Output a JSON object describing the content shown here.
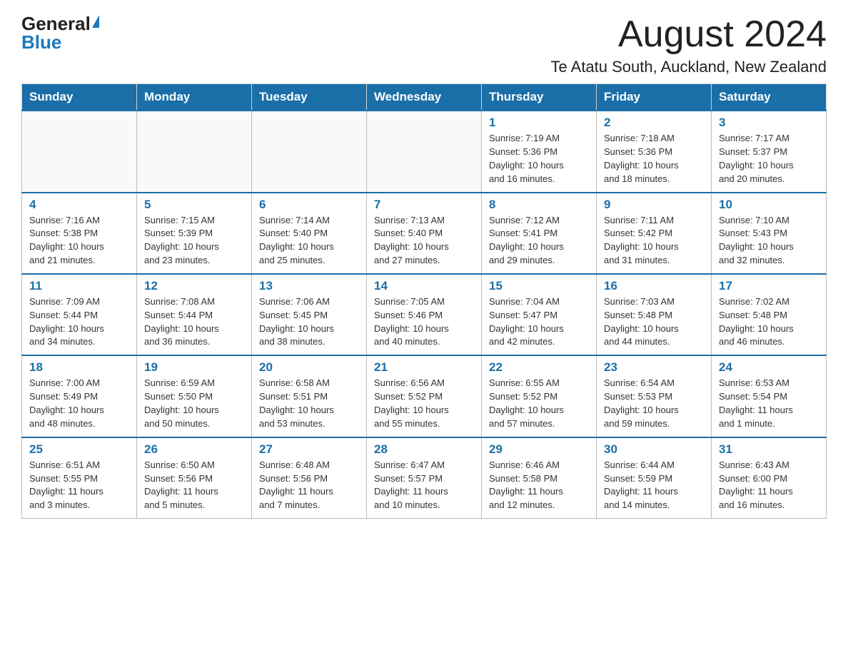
{
  "logo": {
    "general": "General",
    "blue": "Blue"
  },
  "header": {
    "month": "August 2024",
    "location": "Te Atatu South, Auckland, New Zealand"
  },
  "days_of_week": [
    "Sunday",
    "Monday",
    "Tuesday",
    "Wednesday",
    "Thursday",
    "Friday",
    "Saturday"
  ],
  "weeks": [
    [
      {
        "day": "",
        "info": ""
      },
      {
        "day": "",
        "info": ""
      },
      {
        "day": "",
        "info": ""
      },
      {
        "day": "",
        "info": ""
      },
      {
        "day": "1",
        "info": "Sunrise: 7:19 AM\nSunset: 5:36 PM\nDaylight: 10 hours\nand 16 minutes."
      },
      {
        "day": "2",
        "info": "Sunrise: 7:18 AM\nSunset: 5:36 PM\nDaylight: 10 hours\nand 18 minutes."
      },
      {
        "day": "3",
        "info": "Sunrise: 7:17 AM\nSunset: 5:37 PM\nDaylight: 10 hours\nand 20 minutes."
      }
    ],
    [
      {
        "day": "4",
        "info": "Sunrise: 7:16 AM\nSunset: 5:38 PM\nDaylight: 10 hours\nand 21 minutes."
      },
      {
        "day": "5",
        "info": "Sunrise: 7:15 AM\nSunset: 5:39 PM\nDaylight: 10 hours\nand 23 minutes."
      },
      {
        "day": "6",
        "info": "Sunrise: 7:14 AM\nSunset: 5:40 PM\nDaylight: 10 hours\nand 25 minutes."
      },
      {
        "day": "7",
        "info": "Sunrise: 7:13 AM\nSunset: 5:40 PM\nDaylight: 10 hours\nand 27 minutes."
      },
      {
        "day": "8",
        "info": "Sunrise: 7:12 AM\nSunset: 5:41 PM\nDaylight: 10 hours\nand 29 minutes."
      },
      {
        "day": "9",
        "info": "Sunrise: 7:11 AM\nSunset: 5:42 PM\nDaylight: 10 hours\nand 31 minutes."
      },
      {
        "day": "10",
        "info": "Sunrise: 7:10 AM\nSunset: 5:43 PM\nDaylight: 10 hours\nand 32 minutes."
      }
    ],
    [
      {
        "day": "11",
        "info": "Sunrise: 7:09 AM\nSunset: 5:44 PM\nDaylight: 10 hours\nand 34 minutes."
      },
      {
        "day": "12",
        "info": "Sunrise: 7:08 AM\nSunset: 5:44 PM\nDaylight: 10 hours\nand 36 minutes."
      },
      {
        "day": "13",
        "info": "Sunrise: 7:06 AM\nSunset: 5:45 PM\nDaylight: 10 hours\nand 38 minutes."
      },
      {
        "day": "14",
        "info": "Sunrise: 7:05 AM\nSunset: 5:46 PM\nDaylight: 10 hours\nand 40 minutes."
      },
      {
        "day": "15",
        "info": "Sunrise: 7:04 AM\nSunset: 5:47 PM\nDaylight: 10 hours\nand 42 minutes."
      },
      {
        "day": "16",
        "info": "Sunrise: 7:03 AM\nSunset: 5:48 PM\nDaylight: 10 hours\nand 44 minutes."
      },
      {
        "day": "17",
        "info": "Sunrise: 7:02 AM\nSunset: 5:48 PM\nDaylight: 10 hours\nand 46 minutes."
      }
    ],
    [
      {
        "day": "18",
        "info": "Sunrise: 7:00 AM\nSunset: 5:49 PM\nDaylight: 10 hours\nand 48 minutes."
      },
      {
        "day": "19",
        "info": "Sunrise: 6:59 AM\nSunset: 5:50 PM\nDaylight: 10 hours\nand 50 minutes."
      },
      {
        "day": "20",
        "info": "Sunrise: 6:58 AM\nSunset: 5:51 PM\nDaylight: 10 hours\nand 53 minutes."
      },
      {
        "day": "21",
        "info": "Sunrise: 6:56 AM\nSunset: 5:52 PM\nDaylight: 10 hours\nand 55 minutes."
      },
      {
        "day": "22",
        "info": "Sunrise: 6:55 AM\nSunset: 5:52 PM\nDaylight: 10 hours\nand 57 minutes."
      },
      {
        "day": "23",
        "info": "Sunrise: 6:54 AM\nSunset: 5:53 PM\nDaylight: 10 hours\nand 59 minutes."
      },
      {
        "day": "24",
        "info": "Sunrise: 6:53 AM\nSunset: 5:54 PM\nDaylight: 11 hours\nand 1 minute."
      }
    ],
    [
      {
        "day": "25",
        "info": "Sunrise: 6:51 AM\nSunset: 5:55 PM\nDaylight: 11 hours\nand 3 minutes."
      },
      {
        "day": "26",
        "info": "Sunrise: 6:50 AM\nSunset: 5:56 PM\nDaylight: 11 hours\nand 5 minutes."
      },
      {
        "day": "27",
        "info": "Sunrise: 6:48 AM\nSunset: 5:56 PM\nDaylight: 11 hours\nand 7 minutes."
      },
      {
        "day": "28",
        "info": "Sunrise: 6:47 AM\nSunset: 5:57 PM\nDaylight: 11 hours\nand 10 minutes."
      },
      {
        "day": "29",
        "info": "Sunrise: 6:46 AM\nSunset: 5:58 PM\nDaylight: 11 hours\nand 12 minutes."
      },
      {
        "day": "30",
        "info": "Sunrise: 6:44 AM\nSunset: 5:59 PM\nDaylight: 11 hours\nand 14 minutes."
      },
      {
        "day": "31",
        "info": "Sunrise: 6:43 AM\nSunset: 6:00 PM\nDaylight: 11 hours\nand 16 minutes."
      }
    ]
  ]
}
